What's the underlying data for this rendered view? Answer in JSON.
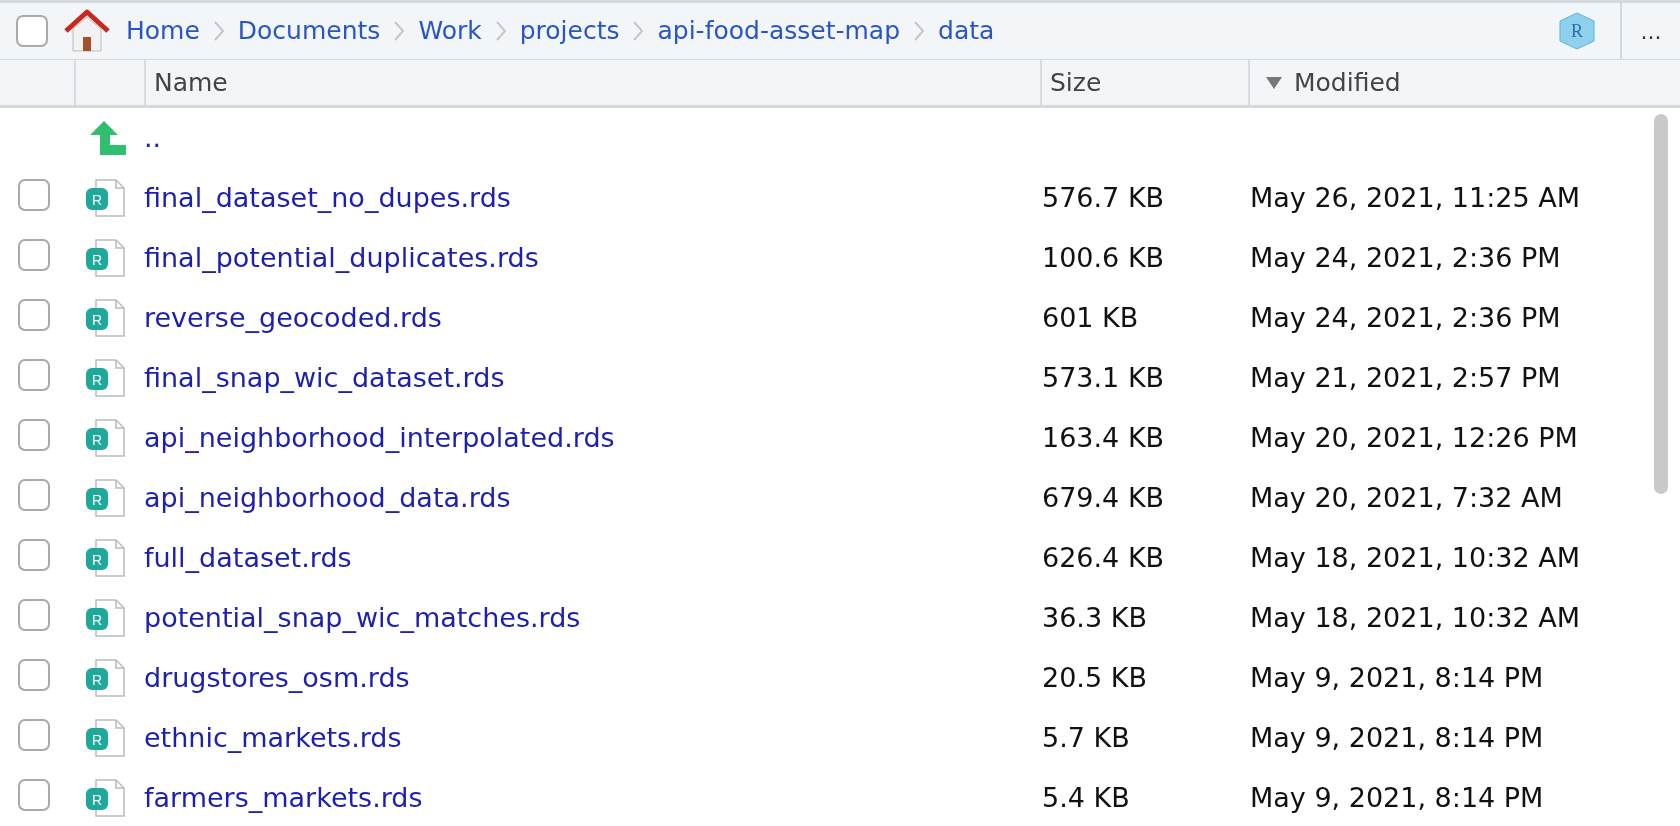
{
  "toolbar": {
    "select_all_checked": false,
    "breadcrumb": [
      "Home",
      "Documents",
      "Work",
      "projects",
      "api-food-asset-map",
      "data"
    ],
    "project_icon_letter": "R",
    "more_label": "..."
  },
  "columns": [
    {
      "label": "Name",
      "sorted_descending": false
    },
    {
      "label": "Size",
      "sorted_descending": false
    },
    {
      "label": "Modified",
      "sorted_descending": true
    }
  ],
  "parent_row": {
    "label": ".."
  },
  "files": [
    {
      "icon_letter": "R",
      "name": "final_dataset_no_dupes.rds",
      "size": "576.7 KB",
      "modified": "May 26, 2021, 11:25 AM",
      "checked": false
    },
    {
      "icon_letter": "R",
      "name": "final_potential_duplicates.rds",
      "size": "100.6 KB",
      "modified": "May 24, 2021, 2:36 PM",
      "checked": false
    },
    {
      "icon_letter": "R",
      "name": "reverse_geocoded.rds",
      "size": "601 KB",
      "modified": "May 24, 2021, 2:36 PM",
      "checked": false
    },
    {
      "icon_letter": "R",
      "name": "final_snap_wic_dataset.rds",
      "size": "573.1 KB",
      "modified": "May 21, 2021, 2:57 PM",
      "checked": false
    },
    {
      "icon_letter": "R",
      "name": "api_neighborhood_interpolated.rds",
      "size": "163.4 KB",
      "modified": "May 20, 2021, 12:26 PM",
      "checked": false
    },
    {
      "icon_letter": "R",
      "name": "api_neighborhood_data.rds",
      "size": "679.4 KB",
      "modified": "May 20, 2021, 7:32 AM",
      "checked": false
    },
    {
      "icon_letter": "R",
      "name": "full_dataset.rds",
      "size": "626.4 KB",
      "modified": "May 18, 2021, 10:32 AM",
      "checked": false
    },
    {
      "icon_letter": "R",
      "name": "potential_snap_wic_matches.rds",
      "size": "36.3 KB",
      "modified": "May 18, 2021, 10:32 AM",
      "checked": false
    },
    {
      "icon_letter": "R",
      "name": "drugstores_osm.rds",
      "size": "20.5 KB",
      "modified": "May 9, 2021, 8:14 PM",
      "checked": false
    },
    {
      "icon_letter": "R",
      "name": "ethnic_markets.rds",
      "size": "5.7 KB",
      "modified": "May 9, 2021, 8:14 PM",
      "checked": false
    },
    {
      "icon_letter": "R",
      "name": "farmers_markets.rds",
      "size": "5.4 KB",
      "modified": "May 9, 2021, 8:14 PM",
      "checked": false
    }
  ]
}
